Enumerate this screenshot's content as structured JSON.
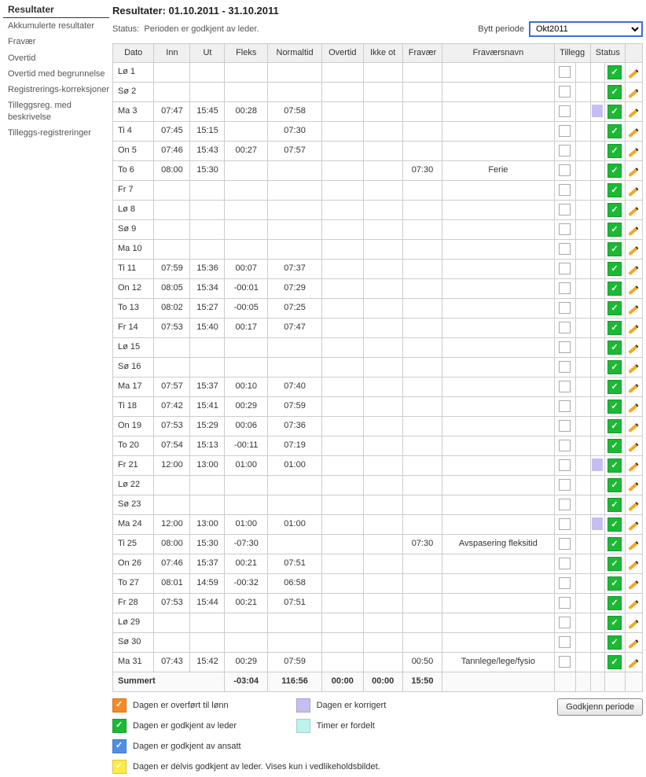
{
  "sidebar": {
    "heading": "Resultater",
    "items": [
      "Akkumulerte resultater",
      "Fravær",
      "Overtid",
      "Overtid med begrunnelse",
      "Registrerings-korreksjoner",
      "Tilleggsreg. med beskrivelse",
      "Tilleggs-registreringer"
    ]
  },
  "header": {
    "title": "Resultater: 01.10.2011 - 31.10.2011",
    "status_label": "Status:",
    "status_text": "Perioden er godkjent av leder.",
    "period_label": "Bytt periode",
    "period_value": "Okt2011"
  },
  "columns": {
    "dato": "Dato",
    "inn": "Inn",
    "ut": "Ut",
    "fleks": "Fleks",
    "normaltid": "Normaltid",
    "overtid": "Overtid",
    "ikkeot": "Ikke ot",
    "fravaer": "Fravær",
    "navn": "Fraværsnavn",
    "tillegg": "Tillegg",
    "status": "Status"
  },
  "rows": [
    {
      "dato": "Lø 1",
      "inn": "",
      "ut": "",
      "fleks": "",
      "norm": "",
      "over": "",
      "ikke": "",
      "frav": "",
      "navn": "",
      "extra": ""
    },
    {
      "dato": "Sø 2",
      "inn": "",
      "ut": "",
      "fleks": "",
      "norm": "",
      "over": "",
      "ikke": "",
      "frav": "",
      "navn": "",
      "extra": ""
    },
    {
      "dato": "Ma 3",
      "inn": "07:47",
      "ut": "15:45",
      "fleks": "00:28",
      "norm": "07:58",
      "over": "",
      "ikke": "",
      "frav": "",
      "navn": "",
      "extra": "fill"
    },
    {
      "dato": "Ti 4",
      "inn": "07:45",
      "ut": "15:15",
      "fleks": "",
      "norm": "07:30",
      "over": "",
      "ikke": "",
      "frav": "",
      "navn": "",
      "extra": ""
    },
    {
      "dato": "On 5",
      "inn": "07:46",
      "ut": "15:43",
      "fleks": "00:27",
      "norm": "07:57",
      "over": "",
      "ikke": "",
      "frav": "",
      "navn": "",
      "extra": ""
    },
    {
      "dato": "To 6",
      "inn": "08:00",
      "ut": "15:30",
      "fleks": "",
      "norm": "",
      "over": "",
      "ikke": "",
      "frav": "07:30",
      "navn": "Ferie",
      "extra": ""
    },
    {
      "dato": "Fr 7",
      "inn": "",
      "ut": "",
      "fleks": "",
      "norm": "",
      "over": "",
      "ikke": "",
      "frav": "",
      "navn": "",
      "extra": ""
    },
    {
      "dato": "Lø 8",
      "inn": "",
      "ut": "",
      "fleks": "",
      "norm": "",
      "over": "",
      "ikke": "",
      "frav": "",
      "navn": "",
      "extra": ""
    },
    {
      "dato": "Sø 9",
      "inn": "",
      "ut": "",
      "fleks": "",
      "norm": "",
      "over": "",
      "ikke": "",
      "frav": "",
      "navn": "",
      "extra": ""
    },
    {
      "dato": "Ma 10",
      "inn": "",
      "ut": "",
      "fleks": "",
      "norm": "",
      "over": "",
      "ikke": "",
      "frav": "",
      "navn": "",
      "extra": ""
    },
    {
      "dato": "Ti 11",
      "inn": "07:59",
      "ut": "15:36",
      "fleks": "00:07",
      "norm": "07:37",
      "over": "",
      "ikke": "",
      "frav": "",
      "navn": "",
      "extra": ""
    },
    {
      "dato": "On 12",
      "inn": "08:05",
      "ut": "15:34",
      "fleks": "-00:01",
      "norm": "07:29",
      "over": "",
      "ikke": "",
      "frav": "",
      "navn": "",
      "extra": ""
    },
    {
      "dato": "To 13",
      "inn": "08:02",
      "ut": "15:27",
      "fleks": "-00:05",
      "norm": "07:25",
      "over": "",
      "ikke": "",
      "frav": "",
      "navn": "",
      "extra": ""
    },
    {
      "dato": "Fr 14",
      "inn": "07:53",
      "ut": "15:40",
      "fleks": "00:17",
      "norm": "07:47",
      "over": "",
      "ikke": "",
      "frav": "",
      "navn": "",
      "extra": ""
    },
    {
      "dato": "Lø 15",
      "inn": "",
      "ut": "",
      "fleks": "",
      "norm": "",
      "over": "",
      "ikke": "",
      "frav": "",
      "navn": "",
      "extra": ""
    },
    {
      "dato": "Sø 16",
      "inn": "",
      "ut": "",
      "fleks": "",
      "norm": "",
      "over": "",
      "ikke": "",
      "frav": "",
      "navn": "",
      "extra": ""
    },
    {
      "dato": "Ma 17",
      "inn": "07:57",
      "ut": "15:37",
      "fleks": "00:10",
      "norm": "07:40",
      "over": "",
      "ikke": "",
      "frav": "",
      "navn": "",
      "extra": ""
    },
    {
      "dato": "Ti 18",
      "inn": "07:42",
      "ut": "15:41",
      "fleks": "00:29",
      "norm": "07:59",
      "over": "",
      "ikke": "",
      "frav": "",
      "navn": "",
      "extra": ""
    },
    {
      "dato": "On 19",
      "inn": "07:53",
      "ut": "15:29",
      "fleks": "00:06",
      "norm": "07:36",
      "over": "",
      "ikke": "",
      "frav": "",
      "navn": "",
      "extra": ""
    },
    {
      "dato": "To 20",
      "inn": "07:54",
      "ut": "15:13",
      "fleks": "-00:11",
      "norm": "07:19",
      "over": "",
      "ikke": "",
      "frav": "",
      "navn": "",
      "extra": ""
    },
    {
      "dato": "Fr 21",
      "inn": "12:00",
      "ut": "13:00",
      "fleks": "01:00",
      "norm": "01:00",
      "over": "",
      "ikke": "",
      "frav": "",
      "navn": "",
      "extra": "fill"
    },
    {
      "dato": "Lø 22",
      "inn": "",
      "ut": "",
      "fleks": "",
      "norm": "",
      "over": "",
      "ikke": "",
      "frav": "",
      "navn": "",
      "extra": ""
    },
    {
      "dato": "Sø 23",
      "inn": "",
      "ut": "",
      "fleks": "",
      "norm": "",
      "over": "",
      "ikke": "",
      "frav": "",
      "navn": "",
      "extra": ""
    },
    {
      "dato": "Ma 24",
      "inn": "12:00",
      "ut": "13:00",
      "fleks": "01:00",
      "norm": "01:00",
      "over": "",
      "ikke": "",
      "frav": "",
      "navn": "",
      "extra": "fill"
    },
    {
      "dato": "Ti 25",
      "inn": "08:00",
      "ut": "15:30",
      "fleks": "-07:30",
      "norm": "",
      "over": "",
      "ikke": "",
      "frav": "07:30",
      "navn": "Avspasering fleksitid",
      "extra": ""
    },
    {
      "dato": "On 26",
      "inn": "07:46",
      "ut": "15:37",
      "fleks": "00:21",
      "norm": "07:51",
      "over": "",
      "ikke": "",
      "frav": "",
      "navn": "",
      "extra": ""
    },
    {
      "dato": "To 27",
      "inn": "08:01",
      "ut": "14:59",
      "fleks": "-00:32",
      "norm": "06:58",
      "over": "",
      "ikke": "",
      "frav": "",
      "navn": "",
      "extra": ""
    },
    {
      "dato": "Fr 28",
      "inn": "07:53",
      "ut": "15:44",
      "fleks": "00:21",
      "norm": "07:51",
      "over": "",
      "ikke": "",
      "frav": "",
      "navn": "",
      "extra": ""
    },
    {
      "dato": "Lø 29",
      "inn": "",
      "ut": "",
      "fleks": "",
      "norm": "",
      "over": "",
      "ikke": "",
      "frav": "",
      "navn": "",
      "extra": ""
    },
    {
      "dato": "Sø 30",
      "inn": "",
      "ut": "",
      "fleks": "",
      "norm": "",
      "over": "",
      "ikke": "",
      "frav": "",
      "navn": "",
      "extra": ""
    },
    {
      "dato": "Ma 31",
      "inn": "07:43",
      "ut": "15:42",
      "fleks": "00:29",
      "norm": "07:59",
      "over": "",
      "ikke": "",
      "frav": "00:50",
      "navn": "Tannlege/lege/fysio",
      "extra": ""
    }
  ],
  "summary": {
    "label": "Summert",
    "fleks": "-03:04",
    "norm": "116:56",
    "over": "00:00",
    "ikke": "00:00",
    "frav": "15:50"
  },
  "legend": {
    "orange": "Dagen er overført til lønn",
    "pale": "Dagen er korrigert",
    "green": "Dagen er godkjent av leder",
    "cyan": "Timer er fordelt",
    "blue": "Dagen er godkjent av ansatt",
    "yellow": "Dagen er delvis godkjent av leder. Vises kun i vedlikeholdsbildet."
  },
  "buttons": {
    "approve": "Godkjenn periode"
  }
}
